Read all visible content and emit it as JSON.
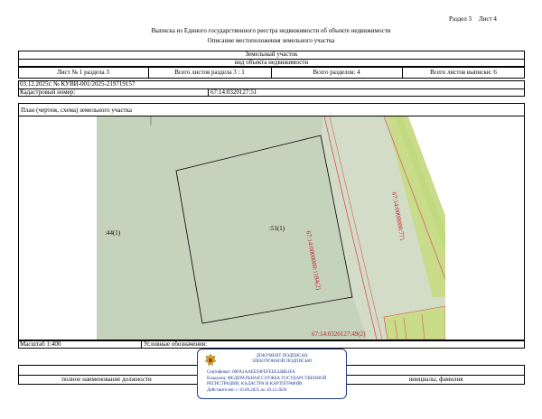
{
  "header": {
    "section_label": "Раздел 3",
    "sheet_label": "Лист 4",
    "title": "Выписка из Единого государственного реестра недвижимости об объекте недвижимости",
    "subtitle": "Описание местоположения земельного участка"
  },
  "object": {
    "type": "Земельный участок",
    "type_caption": "вид объекта недвижимости"
  },
  "counts": {
    "sheet_of_section": "Лист № 1 раздела 3",
    "total_sheets_section": "Всего листов раздела 3 : 1",
    "total_sections": "Всего разделов: 4",
    "total_sheets_extract": "Всего листов выписки: 6"
  },
  "record": {
    "date_number": "03.12.2025г. № КУВИ-001/2025-219719157",
    "cadastral_label": "Кадастровый номер:",
    "cadastral_value": "67:14:0320127:51"
  },
  "plan": {
    "title": "План (чертеж, схема) земельного участка",
    "label_left_parcel": ":44(1)",
    "label_main_parcel": ":51(1)",
    "label_strip_1": "67:14:0000000:1184(2)",
    "label_strip_2": "67:14:0000000:771",
    "label_bottom": "67:14:0320127:49(2)",
    "colors": {
      "parcel_fill": "#c6d3bc",
      "strip_fill": "#d5dfb2",
      "highlight": "#bfd97a",
      "red_line": "#e0404a"
    }
  },
  "footer": {
    "scale": "Масштаб 1:400",
    "legend_label": "Условные обозначения:",
    "position_caption": "полное наименование должности",
    "signature_caption": "инициалы, фамилия"
  },
  "stamp": {
    "line1": "ДОКУМЕНТ ПОДПИСАН",
    "line2": "ЭЛЕКТРОННОЙ ПОДПИСЬЮ",
    "cert": "Сертификат: 00FA1AAEE94FEFEEE44BE4FA",
    "owner_line1": "Владелец: ФЕДЕРАЛЬНАЯ СЛУЖБА ГОСУДАРСТВЕННОЙ",
    "owner_line2": "РЕГИСТРАЦИИ, КАДАСТРА И КАРТОГРАФИИ",
    "valid": "Действителен: с 16.09.2025 по 10.12.2026",
    "emblem": "emblem-icon"
  }
}
